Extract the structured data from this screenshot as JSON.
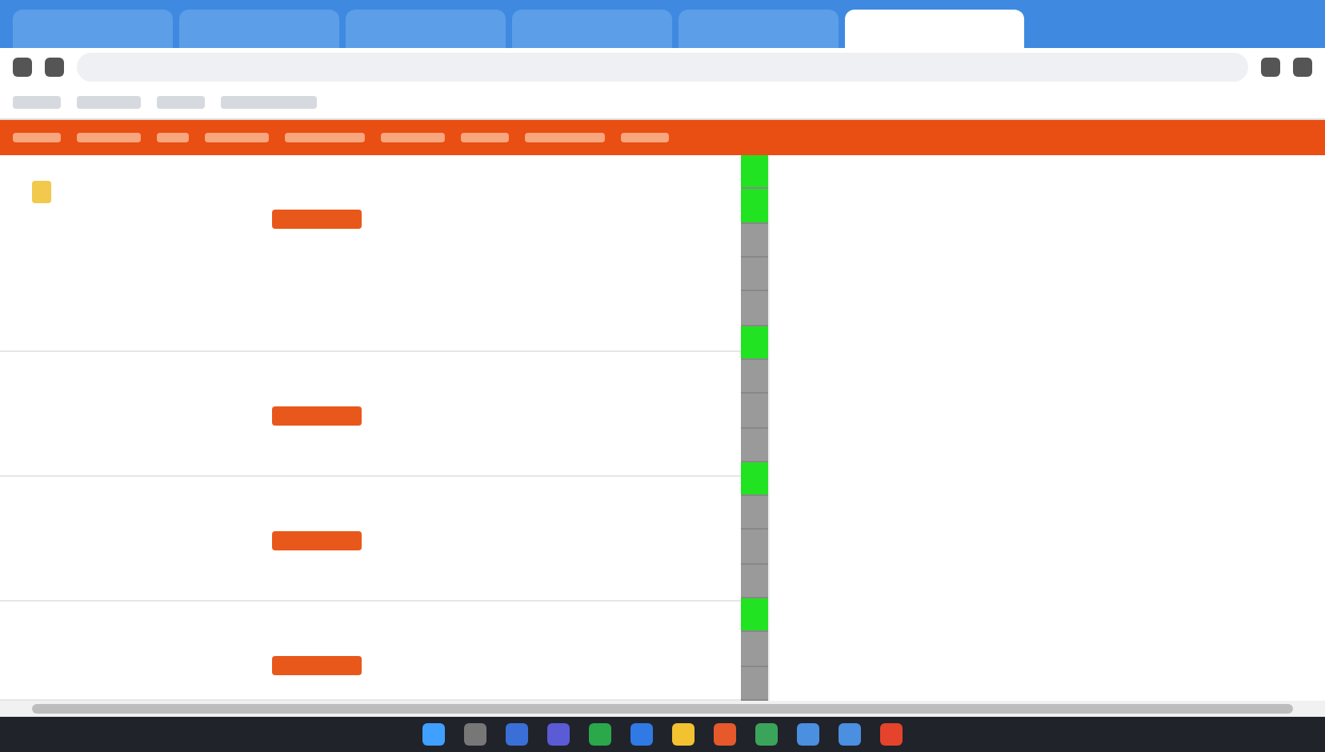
{
  "browser_tabs": [
    {
      "selected": false
    },
    {
      "selected": false
    },
    {
      "selected": false
    },
    {
      "selected": false
    },
    {
      "selected": false
    },
    {
      "selected": true
    }
  ],
  "status_cells": [
    {
      "color": "#22e322"
    },
    {
      "color": "#22e322"
    },
    {
      "color": "#9a9a9a"
    },
    {
      "color": "#9a9a9a"
    },
    {
      "color": "#9a9a9a"
    },
    {
      "color": "#22e322"
    },
    {
      "color": "#9a9a9a"
    },
    {
      "color": "#9a9a9a"
    },
    {
      "color": "#9a9a9a"
    },
    {
      "color": "#22e322"
    },
    {
      "color": "#9a9a9a"
    },
    {
      "color": "#9a9a9a"
    },
    {
      "color": "#9a9a9a"
    },
    {
      "color": "#22e322"
    },
    {
      "color": "#9a9a9a"
    },
    {
      "color": "#9a9a9a"
    }
  ],
  "row_groups": [
    {
      "kind": "tall"
    },
    {
      "kind": "normal"
    },
    {
      "kind": "normal"
    },
    {
      "kind": "cut"
    }
  ]
}
